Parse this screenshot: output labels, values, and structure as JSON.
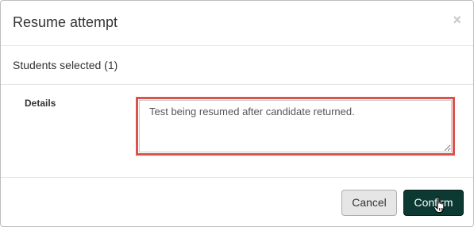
{
  "dialog": {
    "title": "Resume attempt",
    "close_label": "×"
  },
  "selection": {
    "label": "Students selected (1)"
  },
  "form": {
    "details_label": "Details",
    "details_value": "Test being resumed after candidate returned."
  },
  "actions": {
    "cancel_label": "Cancel",
    "confirm_label": "Confirm"
  },
  "colors": {
    "highlight_border": "#d9534f",
    "confirm_bg": "#0c3a32",
    "cancel_bg": "#e6e6e6"
  },
  "icons": {
    "close": "close-icon",
    "cursor": "hand-pointer-icon"
  }
}
